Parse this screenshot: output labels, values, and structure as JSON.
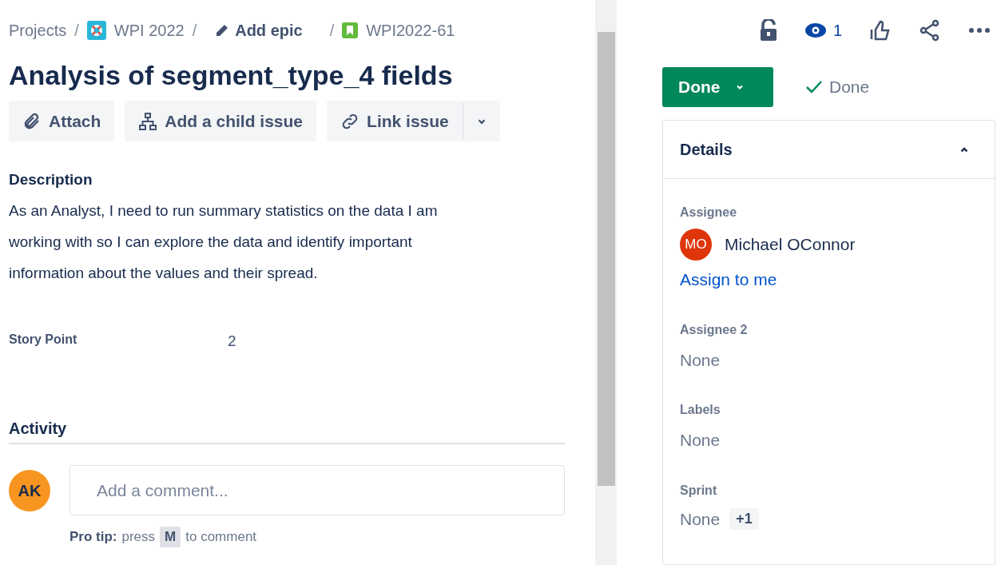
{
  "breadcrumbs": {
    "projects": "Projects",
    "project": "WPI 2022",
    "epic": "Add epic",
    "issue": "WPI2022-61",
    "separator": "/"
  },
  "title": "Analysis of segment_type_4 fields",
  "actions": [
    "Attach",
    "Add a child issue",
    "Link issue"
  ],
  "description": {
    "heading": "Description",
    "text": "As an Analyst, I need to run summary statistics on the data I am working with so I can explore the data and identify important information about the values and their spread."
  },
  "story_point": {
    "label": "Story Point",
    "value": "2"
  },
  "activity": {
    "heading": "Activity",
    "avatar": "AK",
    "placeholder": "Add a comment...",
    "pro_tip": {
      "label": "Pro tip:",
      "before": "press",
      "key": "M",
      "after": "to comment"
    }
  },
  "watchers": "1",
  "status": {
    "button": "Done",
    "resolution": "Done"
  },
  "details": {
    "heading": "Details",
    "expanded": true,
    "assignee": {
      "label": "Assignee",
      "avatar": "MO",
      "name": "Michael OConnor",
      "link": "Assign to me"
    },
    "fields": [
      {
        "label": "Assignee 2",
        "value": "None"
      },
      {
        "label": "Labels",
        "value": "None"
      }
    ],
    "sprint": {
      "label": "Sprint",
      "value": "None",
      "extra": "+1"
    }
  }
}
